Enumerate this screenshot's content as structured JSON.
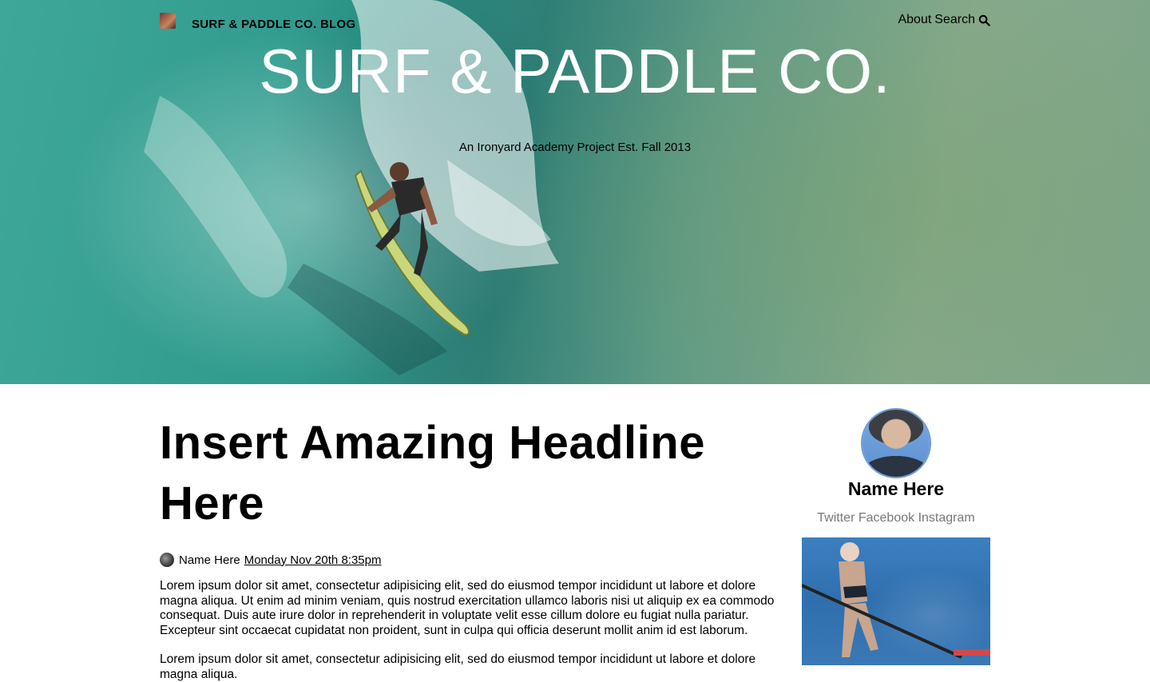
{
  "header": {
    "brand": "SURF & PADDLE CO. BLOG",
    "nav": {
      "about": "About",
      "search": "Search"
    }
  },
  "hero": {
    "title": "SURF & PADDLE CO.",
    "tagline": "An Ironyard Academy Project Est. Fall 2013"
  },
  "article": {
    "headline": "Insert Amazing Headline Here",
    "author": "Name Here",
    "date": "Monday Nov 20th 8:35pm",
    "paragraphs": [
      "Lorem ipsum dolor sit amet, consectetur adipisicing elit, sed do eiusmod tempor incididunt ut labore et dolore magna aliqua. Ut enim ad minim veniam, quis nostrud exercitation ullamco laboris nisi ut aliquip ex ea commodo consequat. Duis aute irure dolor in reprehenderit in voluptate velit esse cillum dolore eu fugiat nulla pariatur. Excepteur sint occaecat cupidatat non proident, sunt in culpa qui officia deserunt mollit anim id est laborum.",
      "Lorem ipsum dolor sit amet, consectetur adipisicing elit, sed do eiusmod tempor incididunt ut labore et dolore magna aliqua."
    ]
  },
  "sidebar": {
    "name": "Name Here",
    "social": [
      "Twitter",
      "Facebook",
      "Instagram"
    ]
  }
}
